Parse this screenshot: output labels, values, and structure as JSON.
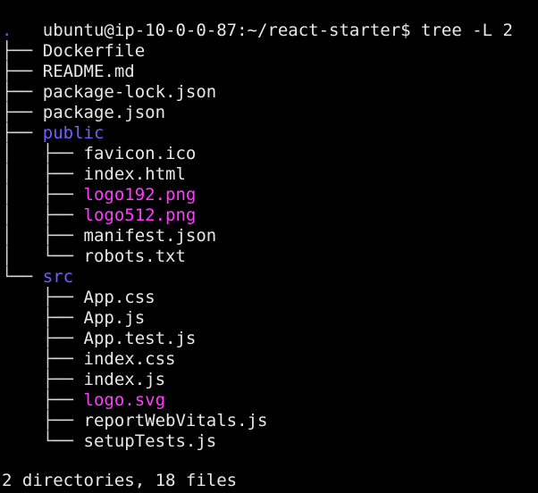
{
  "terminal": {
    "prompt": "ubuntu@ip-10-0-0-87:~/react-starter$",
    "command": "tree -L 2",
    "root": ".",
    "rows": [
      {
        "prefix": "├── ",
        "name": "Dockerfile",
        "kind": "file"
      },
      {
        "prefix": "├── ",
        "name": "README.md",
        "kind": "file"
      },
      {
        "prefix": "├── ",
        "name": "package-lock.json",
        "kind": "file"
      },
      {
        "prefix": "├── ",
        "name": "package.json",
        "kind": "file"
      },
      {
        "prefix": "├── ",
        "name": "public",
        "kind": "dir"
      },
      {
        "prefix": "│   ├── ",
        "name": "favicon.ico",
        "kind": "file"
      },
      {
        "prefix": "│   ├── ",
        "name": "index.html",
        "kind": "file"
      },
      {
        "prefix": "│   ├── ",
        "name": "logo192.png",
        "kind": "image"
      },
      {
        "prefix": "│   ├── ",
        "name": "logo512.png",
        "kind": "image"
      },
      {
        "prefix": "│   ├── ",
        "name": "manifest.json",
        "kind": "file"
      },
      {
        "prefix": "│   └── ",
        "name": "robots.txt",
        "kind": "file"
      },
      {
        "prefix": "└── ",
        "name": "src",
        "kind": "dir"
      },
      {
        "prefix": "    ├── ",
        "name": "App.css",
        "kind": "file"
      },
      {
        "prefix": "    ├── ",
        "name": "App.js",
        "kind": "file"
      },
      {
        "prefix": "    ├── ",
        "name": "App.test.js",
        "kind": "file"
      },
      {
        "prefix": "    ├── ",
        "name": "index.css",
        "kind": "file"
      },
      {
        "prefix": "    ├── ",
        "name": "index.js",
        "kind": "file"
      },
      {
        "prefix": "    ├── ",
        "name": "logo.svg",
        "kind": "image"
      },
      {
        "prefix": "    ├── ",
        "name": "reportWebVitals.js",
        "kind": "file"
      },
      {
        "prefix": "    └── ",
        "name": "setupTests.js",
        "kind": "file"
      }
    ],
    "summary": "2 directories, 18 files",
    "colors": {
      "background": "#000000",
      "text": "#e8e8e8",
      "directory": "#6b63ff",
      "image": "#ff3cff"
    }
  }
}
